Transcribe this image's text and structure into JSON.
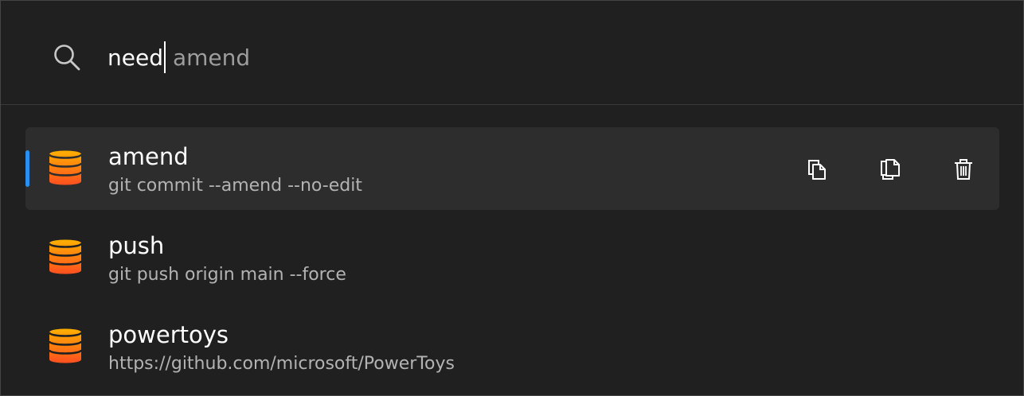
{
  "search": {
    "typed": "need",
    "suggestion": "amend"
  },
  "results": [
    {
      "title": "amend",
      "subtitle": "git commit --amend --no-edit",
      "icon": "database-icon",
      "selected": true,
      "actions": [
        {
          "name": "copy-icon"
        },
        {
          "name": "paste-icon"
        },
        {
          "name": "delete-icon"
        }
      ]
    },
    {
      "title": "push",
      "subtitle": "git push origin main --force",
      "icon": "database-icon",
      "selected": false
    },
    {
      "title": "powertoys",
      "subtitle": "https://github.com/microsoft/PowerToys",
      "icon": "database-icon",
      "selected": false
    }
  ],
  "colors": {
    "accent": "#2b8ff1",
    "icon_top": "#ffb000",
    "icon_bottom": "#ff4f1f"
  }
}
